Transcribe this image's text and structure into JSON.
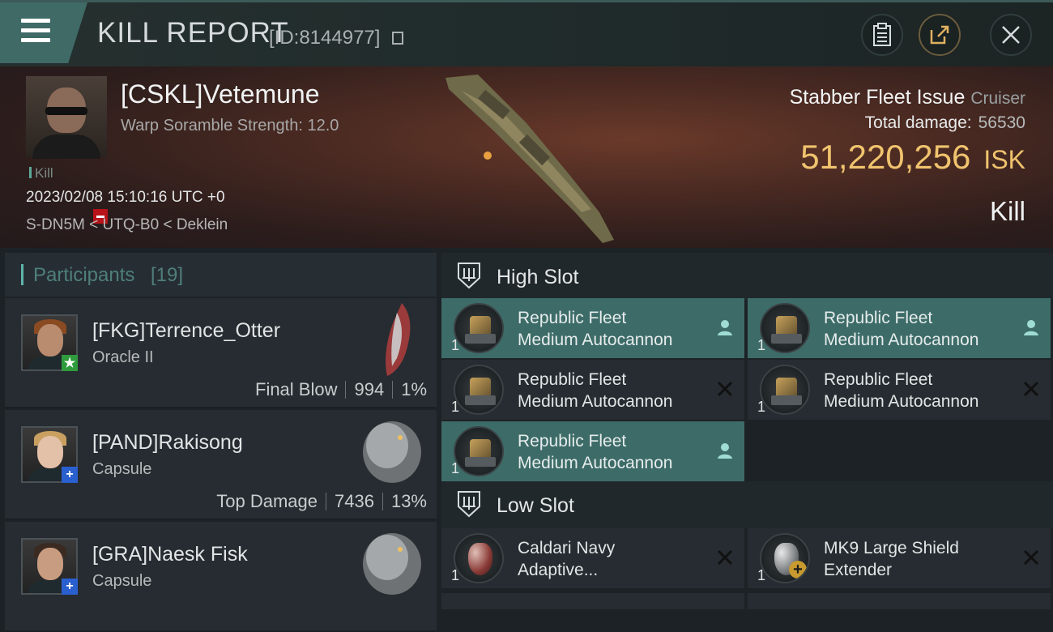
{
  "header": {
    "title": "KILL REPORT",
    "report_id": "[ID:8144977]"
  },
  "victim": {
    "name": "[CSKL]Vetemune",
    "subtitle": "Warp Soramble Strength: 12.0",
    "tag": "Kill",
    "timestamp": "2023/02/08 15:10:16 UTC +0",
    "location": "S-DN5M < UTQ-B0 < Deklein",
    "ship": "Stabber Fleet Issue",
    "ship_class": "Cruiser",
    "total_damage_label": "Total damage:",
    "total_damage": "56530",
    "isk_value": "51,220,256",
    "isk_unit": "ISK",
    "result": "Kill"
  },
  "participants": {
    "title": "Participants",
    "count": "[19]",
    "rows": [
      {
        "name": "[FKG]Terrence_Otter",
        "ship": "Oracle II",
        "label": "Final Blow",
        "damage": "994",
        "percent": "1%",
        "badge": "star"
      },
      {
        "name": "[PAND]Rakisong",
        "ship": "Capsule",
        "label": "Top Damage",
        "damage": "7436",
        "percent": "13%",
        "badge": "plus"
      },
      {
        "name": "[GRA]Naesk Fisk",
        "ship": "Capsule",
        "label": "",
        "damage": "",
        "percent": "",
        "badge": "plus"
      }
    ]
  },
  "slots": {
    "high": {
      "title": "High Slot",
      "modules": [
        {
          "line1": "Republic Fleet",
          "line2": "Medium Autocannon",
          "qty": "1",
          "status": "person-icon"
        },
        {
          "line1": "Republic Fleet",
          "line2": "Medium Autocannon",
          "qty": "1",
          "status": "person-icon"
        },
        {
          "line1": "Republic Fleet",
          "line2": "Medium Autocannon",
          "qty": "1",
          "status": "destroyed-icon"
        },
        {
          "line1": "Republic Fleet",
          "line2": "Medium Autocannon",
          "qty": "1",
          "status": "destroyed-icon"
        },
        {
          "line1": "Republic Fleet",
          "line2": "Medium Autocannon",
          "qty": "1",
          "status": "person-icon"
        }
      ]
    },
    "low": {
      "title": "Low Slot",
      "modules": [
        {
          "line1": "Caldari Navy",
          "line2": "Adaptive...",
          "qty": "1",
          "status": "destroyed-icon"
        },
        {
          "line1": "MK9 Large Shield",
          "line2": "Extender",
          "qty": "1",
          "status": "destroyed-icon"
        }
      ]
    }
  },
  "colors": {
    "accent_teal": "#3d6c68",
    "isk_gold": "#f0c36e",
    "final_blow_badge": "#2f9b3c",
    "plus_badge": "#2a5fcf",
    "minus_badge": "#b8131a"
  }
}
